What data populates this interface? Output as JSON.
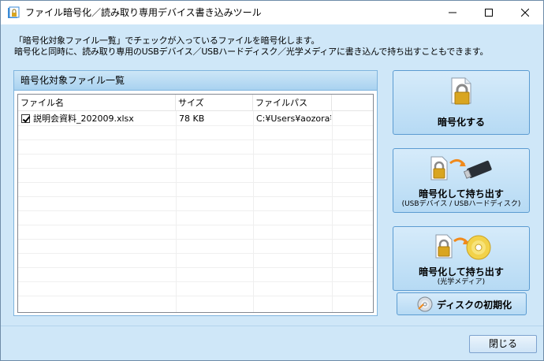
{
  "window": {
    "title": "ファイル暗号化／読み取り専用デバイス書き込みツール"
  },
  "description": {
    "line1": "「暗号化対象ファイル一覧」でチェックが入っているファイルを暗号化します。",
    "line2": "暗号化と同時に、読み取り専用のUSBデバイス／USBハードディスク／光学メディアに書き込んで持ち出すこともできます。"
  },
  "file_list": {
    "title": "暗号化対象ファイル一覧",
    "columns": [
      "ファイル名",
      "サイズ",
      "ファイルパス"
    ],
    "rows": [
      {
        "checked": true,
        "name": "説明会資料_202009.xlsx",
        "size": "78 KB",
        "path": "C:¥Users¥aozora¥..."
      }
    ]
  },
  "actions": {
    "encrypt": {
      "label": "暗号化する",
      "icon": "lock-document-icon"
    },
    "encrypt_usb": {
      "label": "暗号化して持ち出す",
      "sub": "(USBデバイス / USBハードディスク)",
      "icon": "usb-drive-icon"
    },
    "encrypt_optical": {
      "label": "暗号化して持ち出す",
      "sub": "(光学メディア)",
      "icon": "optical-disc-icon"
    },
    "init_disc": {
      "label": "ディスクの初期化",
      "icon": "disc-icon"
    }
  },
  "footer": {
    "close_label": "閉じる"
  },
  "colors": {
    "background": "#cfe7f8",
    "button_border": "#5b9bd1",
    "lock_gold": "#d9a520"
  }
}
